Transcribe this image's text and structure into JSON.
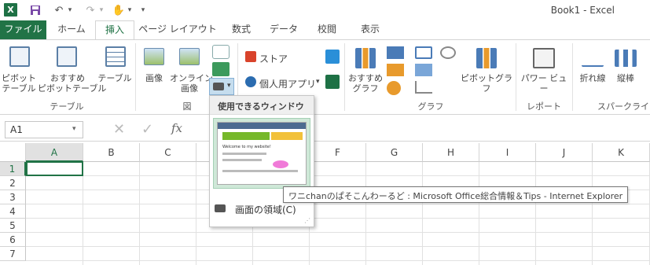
{
  "window": {
    "title": "Book1 - Excel",
    "app_logo": "X"
  },
  "qat": {
    "undo_icon": "↶",
    "redo_icon": "↷",
    "touch_icon": "✋",
    "more_icon": "▾"
  },
  "tabs": [
    "ファイル",
    "ホーム",
    "挿入",
    "ページ レイアウト",
    "数式",
    "データ",
    "校閲",
    "表示"
  ],
  "ribbon": {
    "pivot_table": "ピボット\nテーブル",
    "recommended_pivot": "おすすめ\nピボットテーブル",
    "table": "テーブル",
    "group_table": "テーブル",
    "picture": "画像",
    "online_picture": "オンライン\n画像",
    "group_illustrations": "図",
    "store": "ストア",
    "my_apps": "個人用アプリ",
    "recommended_charts": "おすすめ\nグラフ",
    "pivot_chart": "ピボットグラフ",
    "group_charts": "グラフ",
    "power_view": "パワー ビュー",
    "group_reports": "レポート",
    "sparkline_line": "折れ線",
    "sparkline_column": "縦棒",
    "group_sparklines": "スパークライン"
  },
  "formula_bar": {
    "name_box": "A1",
    "fx": "fx"
  },
  "columns": [
    "A",
    "B",
    "C",
    "D",
    "E",
    "F",
    "G",
    "H",
    "I",
    "J",
    "K"
  ],
  "rows": [
    "1",
    "2",
    "3",
    "4",
    "5",
    "6",
    "7"
  ],
  "screenshot_menu": {
    "header": "使用できるウィンドウ",
    "clip_label": "画面の領域(C)",
    "thumb_text": "Welcome to my website!"
  },
  "tooltip": "ワニchanのぱそこんわーるど : Microsoft Office総合情報＆Tips - Internet Explorer"
}
